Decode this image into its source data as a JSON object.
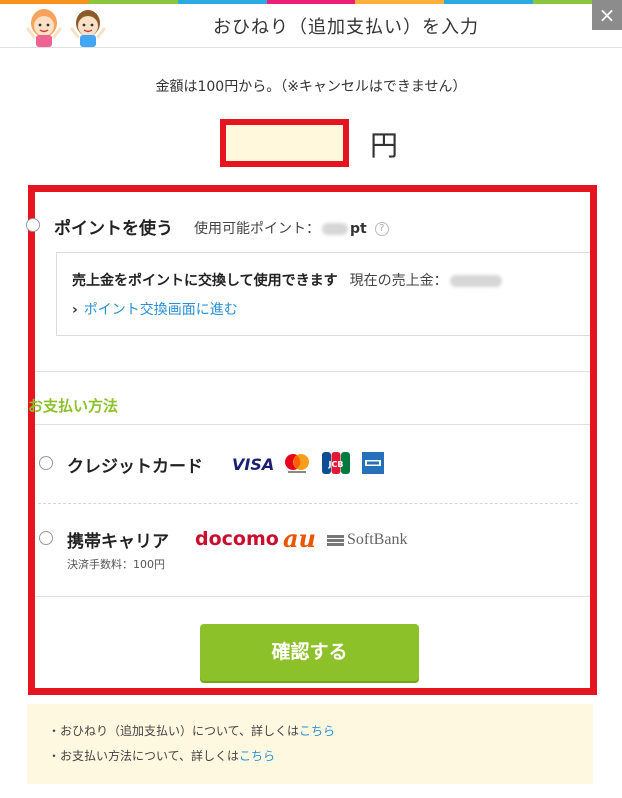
{
  "header": {
    "title": "おひねり（追加支払い）を入力",
    "close_icon": "×"
  },
  "amount": {
    "note": "金額は100円から。（※キャンセルはできません）",
    "value": "",
    "unit": "円"
  },
  "points": {
    "title": "ポイントを使う",
    "available_label": "使用可能ポイント：",
    "unit": "pt",
    "help_icon": "?",
    "sales_text": "売上金をポイントに交換して使用できます",
    "current_sales_label": "現在の売上金：",
    "exchange_link": "ポイント交換画面に進む",
    "chevron": "›"
  },
  "payment": {
    "heading": "お支払い方法",
    "credit_card": {
      "label": "クレジットカード",
      "brands": [
        "VISA",
        "Mastercard",
        "JCB",
        "AMEX"
      ],
      "visa_text": "VISA",
      "jcb_text": "JCB"
    },
    "carrier": {
      "label": "携帯キャリア",
      "fee": "決済手数料：100円",
      "docomo": "docomo",
      "au": "au",
      "softbank": "SoftBank"
    }
  },
  "confirm_button": "確認する",
  "info": {
    "line1_prefix": "・おひねり（追加支払い）について、詳しくは",
    "line1_link": "こちら",
    "line2_prefix": "・お支払い方法について、詳しくは",
    "line2_link": "こちら"
  },
  "colors": {
    "accent_green": "#8cc12a",
    "highlight_red": "#e5141e",
    "link_blue": "#2a8fd6",
    "input_bg": "#fff8dc",
    "info_bg": "#fff8e1",
    "stripe": [
      "#f7931e",
      "#8cc63f",
      "#29abe2",
      "#ed1e79",
      "#fbb03b"
    ]
  },
  "icons": {
    "header_illustration": "two-children-icon",
    "close": "close-icon",
    "help": "question-circle-icon",
    "link_chevron": "chevron-right-icon"
  }
}
